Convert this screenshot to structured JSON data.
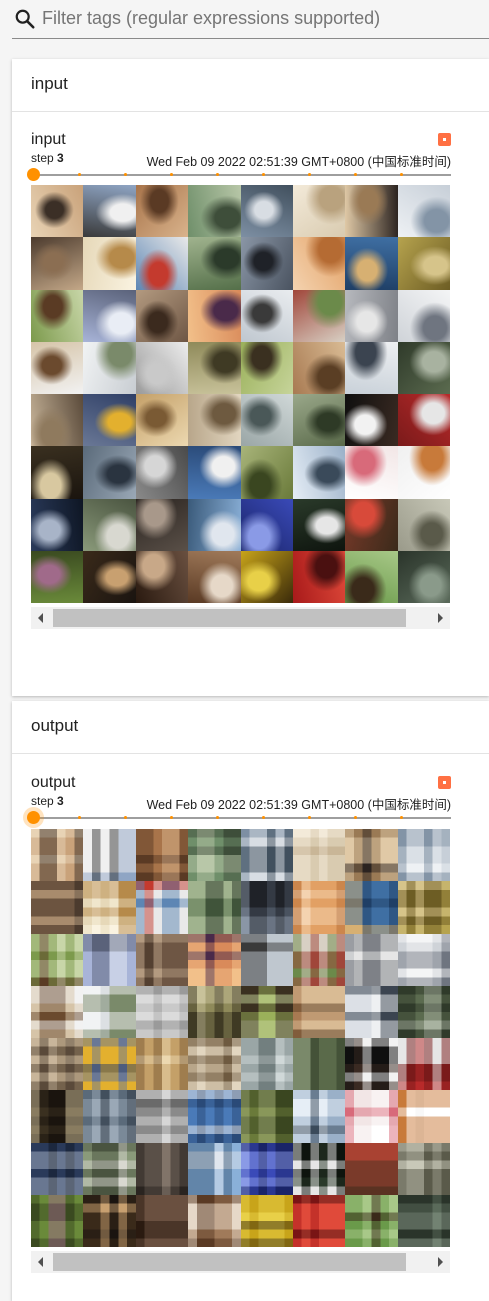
{
  "search": {
    "placeholder": "Filter tags (regular expressions supported)",
    "value": ""
  },
  "colors": {
    "accent": "#ff9100",
    "expand": "#ff7043"
  },
  "sections": [
    {
      "title": "input",
      "card": {
        "tag": "input",
        "step_prefix": "step",
        "step_value": "3",
        "timestamp": "Wed Feb 09 2022 02:51:39 GMT+0800 (中国标准时间)",
        "step_position": 0,
        "image_count": 64
      }
    },
    {
      "title": "output",
      "card": {
        "tag": "output",
        "step_prefix": "step",
        "step_value": "3",
        "timestamp": "Wed Feb 09 2022 02:51:39 GMT+0800 (中国标准时间)",
        "step_position": 0,
        "image_count": 64
      }
    }
  ]
}
